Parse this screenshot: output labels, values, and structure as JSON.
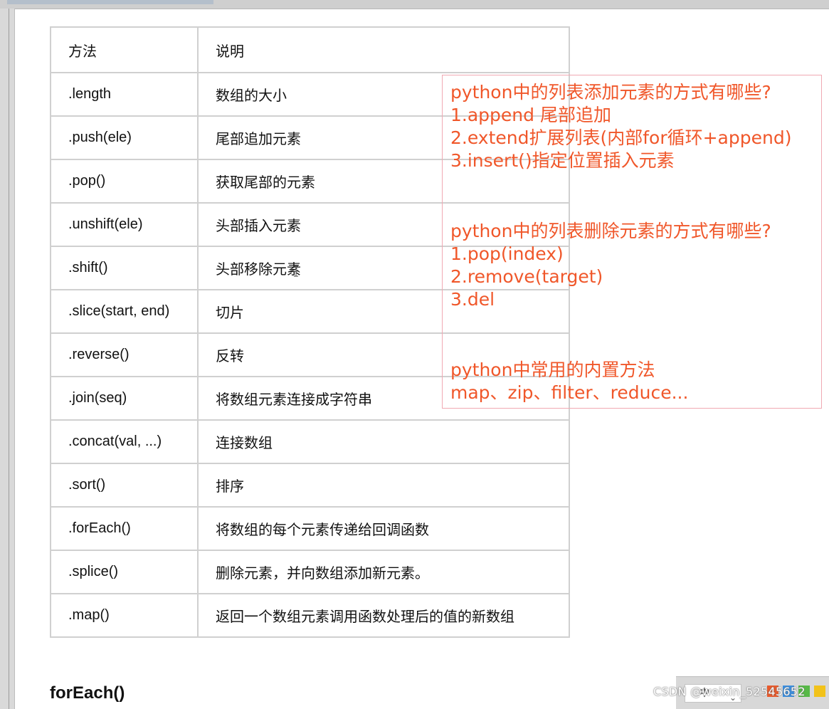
{
  "table": {
    "header": {
      "method": "方法",
      "description": "说明"
    },
    "rows": [
      {
        "method": ".length",
        "description": "数组的大小"
      },
      {
        "method": ".push(ele)",
        "description": "尾部追加元素"
      },
      {
        "method": ".pop()",
        "description": "获取尾部的元素"
      },
      {
        "method": ".unshift(ele)",
        "description": "头部插入元素"
      },
      {
        "method": ".shift()",
        "description": "头部移除元素"
      },
      {
        "method": ".slice(start, end)",
        "description": "切片"
      },
      {
        "method": ".reverse()",
        "description": "反转"
      },
      {
        "method": ".join(seq)",
        "description": "将数组元素连接成字符串"
      },
      {
        "method": ".concat(val, ...)",
        "description": "连接数组"
      },
      {
        "method": ".sort()",
        "description": "排序"
      },
      {
        "method": ".forEach()",
        "description": "将数组的每个元素传递给回调函数"
      },
      {
        "method": ".splice()",
        "description": "删除元素，并向数组添加新元素。"
      },
      {
        "method": ".map()",
        "description": "返回一个数组元素调用函数处理后的值的新数组"
      }
    ]
  },
  "notes": {
    "add_title": "python中的列表添加元素的方式有哪些?",
    "add_1": "1.append 尾部追加",
    "add_2": "2.extend扩展列表(内部for循环+append)",
    "add_3": "3.insert()指定位置插入元素",
    "del_title": "python中的列表删除元素的方式有哪些?",
    "del_1": "1.pop(index)",
    "del_2": "2.remove(target)",
    "del_3": "3.del",
    "builtin_title": "python中常用的内置方法",
    "builtin_list": "map、zip、filter、reduce..."
  },
  "section_heading": "forEach()",
  "ime": {
    "label": "中"
  },
  "watermark": "CSDN @weixin_52545652",
  "colors": {
    "note_text": "#f0572a",
    "note_border": "#f0a9b3",
    "table_border": "#d0d0d0"
  },
  "icons": {
    "cursor": "mouse-pointer-icon",
    "text_caret": "text-cursor-icon"
  }
}
